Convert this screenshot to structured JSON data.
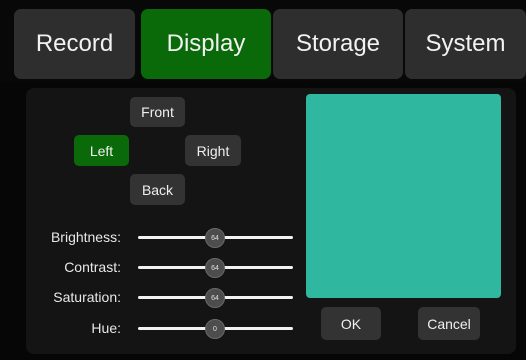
{
  "tabs": [
    {
      "label": "Record",
      "active": false
    },
    {
      "label": "Display",
      "active": true
    },
    {
      "label": "Storage",
      "active": false
    },
    {
      "label": "System",
      "active": false
    }
  ],
  "camera_view": {
    "front_label": "Front",
    "left_label": "Left",
    "right_label": "Right",
    "back_label": "Back",
    "selected": "Left"
  },
  "sliders": [
    {
      "label": "Brightness:",
      "value": "64"
    },
    {
      "label": "Contrast:",
      "value": "64"
    },
    {
      "label": "Saturation:",
      "value": "64"
    },
    {
      "label": "Hue:",
      "value": "0"
    }
  ],
  "preview": {
    "color": "#2fb89f"
  },
  "actions": {
    "ok_label": "OK",
    "cancel_label": "Cancel"
  },
  "colors": {
    "accent": "#0a6a0a",
    "button": "#333333",
    "panel": "#141414"
  }
}
